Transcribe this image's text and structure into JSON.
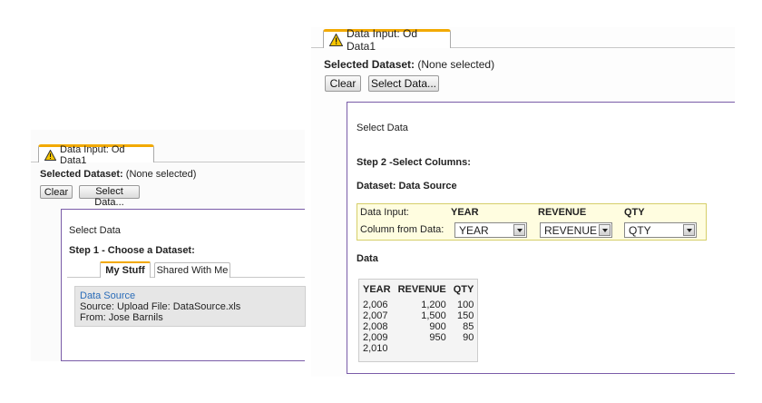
{
  "left": {
    "tab_title": "Data Input: Od Data1",
    "selected_dataset_label": "Selected Dataset:",
    "selected_dataset_value": "(None selected)",
    "clear_label": "Clear",
    "select_data_label": "Select Data...",
    "section_title": "Select Data",
    "step_title": "Step 1 - Choose a Dataset:",
    "tabs": [
      "My Stuff",
      "Shared With Me"
    ],
    "dataset": {
      "name": "Data Source",
      "source": "Source: Upload File: DataSource.xls",
      "from": "From: Jose Barnils"
    }
  },
  "right": {
    "tab_title": "Data Input: Od Data1",
    "selected_dataset_label": "Selected Dataset:",
    "selected_dataset_value": "(None selected)",
    "clear_label": "Clear",
    "select_data_label": "Select Data...",
    "section_title": "Select Data",
    "step_title": "Step 2 -Select Columns:",
    "dataset_title": "Dataset: Data Source",
    "columns": {
      "row1_label": "Data Input:",
      "row2_label": "Column from Data:",
      "headers": [
        "YEAR",
        "REVENUE",
        "QTY"
      ],
      "selected": [
        "YEAR",
        "REVENUE",
        "QTY"
      ]
    },
    "data_title": "Data",
    "table": {
      "headers": [
        "YEAR",
        "REVENUE",
        "QTY"
      ],
      "rows": [
        [
          "2,006",
          "1,200",
          "100"
        ],
        [
          "2,007",
          "1,500",
          "150"
        ],
        [
          "2,008",
          "900",
          "85"
        ],
        [
          "2,009",
          "950",
          "90"
        ],
        [
          "2,010",
          "",
          ""
        ]
      ]
    }
  }
}
